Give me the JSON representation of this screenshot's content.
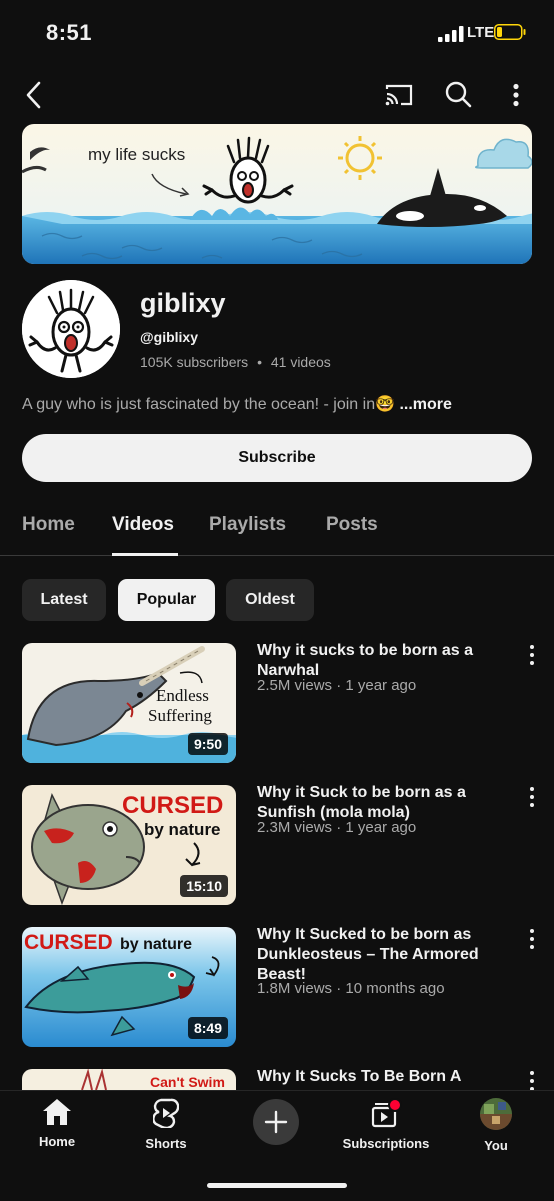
{
  "status_bar": {
    "time": "8:51",
    "network": "LTE"
  },
  "top_bar": {
    "back_icon": "chevron-left-icon",
    "cast_icon": "cast-icon",
    "search_icon": "search-icon",
    "more_icon": "more-vert-icon"
  },
  "banner": {
    "caption": "my life sucks"
  },
  "channel": {
    "name": "giblixy",
    "handle": "@giblixy",
    "subscribers": "105K subscribers",
    "separator": "•",
    "videos_count": "41 videos",
    "description": "A guy who is just fascinated by the ocean! -  join in",
    "description_emoji": "🤓",
    "more_label": "...more",
    "subscribe_label": "Subscribe"
  },
  "tabs": [
    {
      "label": "Home",
      "active": false
    },
    {
      "label": "Videos",
      "active": true
    },
    {
      "label": "Playlists",
      "active": false
    },
    {
      "label": "Posts",
      "active": false
    }
  ],
  "chips": [
    {
      "label": "Latest",
      "active": false
    },
    {
      "label": "Popular",
      "active": true
    },
    {
      "label": "Oldest",
      "active": false
    }
  ],
  "videos": [
    {
      "title": "Why it sucks to be born as a Narwhal",
      "meta": "2.5M views · 1 year ago",
      "duration": "9:50",
      "thumb_text_1": "Endless",
      "thumb_text_2": "Suffering"
    },
    {
      "title": "Why it Suck to be born as a Sunfish (mola mola)",
      "meta": "2.3M views · 1 year ago",
      "duration": "15:10",
      "thumb_text_1": "CURSED",
      "thumb_text_2": "by nature"
    },
    {
      "title": "Why It Sucked to be born as Dunkleosteus – The Armored Beast!",
      "meta": "1.8M views · 10 months ago",
      "duration": "8:49",
      "thumb_text_1": "CURSED",
      "thumb_text_2": "by nature"
    },
    {
      "title": "Why It Sucks To Be Born A",
      "thumb_text_1": "Can't Swim"
    }
  ],
  "bottom_nav": [
    {
      "label": "Home",
      "icon": "home-icon"
    },
    {
      "label": "Shorts",
      "icon": "shorts-icon"
    },
    {
      "label": "",
      "icon": "create-plus-icon"
    },
    {
      "label": "Subscriptions",
      "icon": "subscriptions-icon"
    },
    {
      "label": "You",
      "icon": "avatar-icon"
    }
  ],
  "colors": {
    "background": "#0f0f0f",
    "text": "#f1f1f1",
    "muted": "#aaaaaa",
    "chip": "#272727",
    "accent_red": "#ff0000"
  }
}
